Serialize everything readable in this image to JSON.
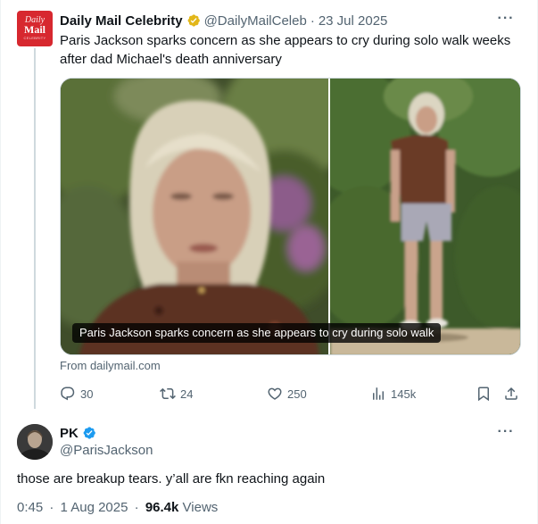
{
  "quoted_tweet": {
    "avatar": {
      "line1": "Daily",
      "line2": "Mail",
      "line3": "CELEBRITY"
    },
    "author_name": "Daily Mail Celebrity",
    "handle": "@DailyMailCeleb",
    "separator": "·",
    "date": "23 Jul 2025",
    "more_label": "···",
    "text": "Paris Jackson sparks concern as she appears to cry during solo walk weeks after dad Michael's death anniversary",
    "media_caption": "Paris Jackson sparks concern as she appears to cry during solo walk",
    "source": "From dailymail.com",
    "actions": {
      "replies": "30",
      "reposts": "24",
      "likes": "250",
      "views": "145k"
    },
    "badge_color": "#e2b719"
  },
  "reply": {
    "author_name": "PK",
    "handle": "@ParisJackson",
    "more_label": "···",
    "text": "those are breakup tears. y’all are fkn reaching again",
    "time": "0:45",
    "separator": "·",
    "date": "1 Aug 2025",
    "separator2": "·",
    "views_count": "96.4k",
    "views_label": "Views",
    "badge_color": "#1d9bf0"
  }
}
